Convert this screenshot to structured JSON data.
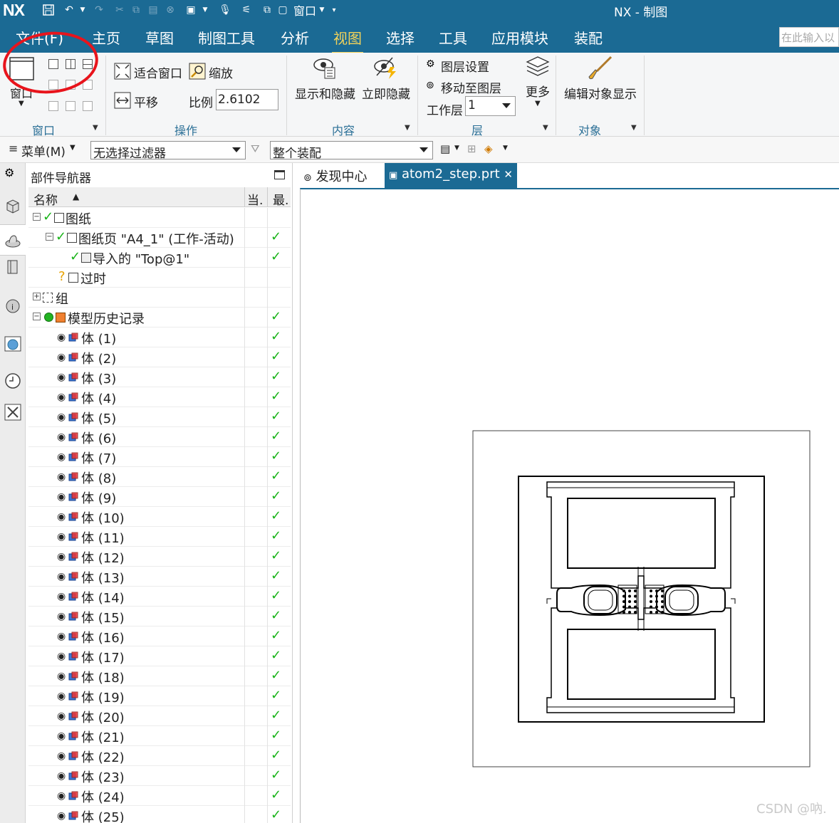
{
  "titlebar": {
    "logo": "NX",
    "app_title": "NX - 制图",
    "quick_access_window": "窗口"
  },
  "menu_tabs": [
    {
      "label": "文件(F)",
      "active": false
    },
    {
      "label": "主页",
      "active": false
    },
    {
      "label": "草图",
      "active": false
    },
    {
      "label": "制图工具",
      "active": false
    },
    {
      "label": "分析",
      "active": false
    },
    {
      "label": "视图",
      "active": true
    },
    {
      "label": "选择",
      "active": false
    },
    {
      "label": "工具",
      "active": false
    },
    {
      "label": "应用模块",
      "active": false
    },
    {
      "label": "装配",
      "active": false
    }
  ],
  "search": {
    "placeholder": "在此输入以"
  },
  "ribbon": {
    "window_group": {
      "label": "窗口",
      "window_button": "窗口"
    },
    "operation_group": {
      "label": "操作",
      "fit": "适合窗口",
      "zoom": "缩放",
      "pan": "平移",
      "scale_label": "比例",
      "scale_value": "2.6102"
    },
    "content_group": {
      "label": "内容",
      "show_hide": "显示和隐藏",
      "immediate_hide": "立即隐藏"
    },
    "layer_group": {
      "label": "层",
      "layer_settings": "图层设置",
      "move_to_layer": "移动至图层",
      "work_layer_label": "工作层",
      "work_layer_value": "1",
      "more": "更多"
    },
    "object_group": {
      "label": "对象",
      "edit_display": "编辑对象显示"
    }
  },
  "filterbar": {
    "menu": "菜单(M)",
    "filter_value": "无选择过滤器",
    "scope_value": "整个装配"
  },
  "navigator": {
    "title": "部件导航器",
    "columns": {
      "name": "名称",
      "current": "当.",
      "latest": "最."
    },
    "tree": [
      {
        "label": "图纸",
        "check": false,
        "level": 0
      },
      {
        "label": "图纸页 \"A4_1\" (工作-活动)",
        "check": true,
        "level": 1
      },
      {
        "label": "导入的 \"Top@1\"",
        "check": true,
        "level": 2
      },
      {
        "label": "过时",
        "check": false,
        "level": 1
      },
      {
        "label": "组",
        "check": false,
        "level": 0
      },
      {
        "label": "模型历史记录",
        "check": true,
        "level": 0
      }
    ],
    "bodies": [
      "体 (1)",
      "体 (2)",
      "体 (3)",
      "体 (4)",
      "体 (5)",
      "体 (6)",
      "体 (7)",
      "体 (8)",
      "体 (9)",
      "体 (10)",
      "体 (11)",
      "体 (12)",
      "体 (13)",
      "体 (14)",
      "体 (15)",
      "体 (16)",
      "体 (17)",
      "体 (18)",
      "体 (19)",
      "体 (20)",
      "体 (21)",
      "体 (22)",
      "体 (23)",
      "体 (24)",
      "体 (25)"
    ]
  },
  "doc_tabs": [
    {
      "label": "发现中心",
      "active": false
    },
    {
      "label": "atom2_step.prt",
      "active": true
    }
  ],
  "watermark": "CSDN @吶.",
  "colors": {
    "titlebar": "#1b6a94",
    "active_tab": "#f3d35a",
    "group_label": "#2a6f96",
    "check": "#17b317",
    "annotation": "#e8141c"
  }
}
